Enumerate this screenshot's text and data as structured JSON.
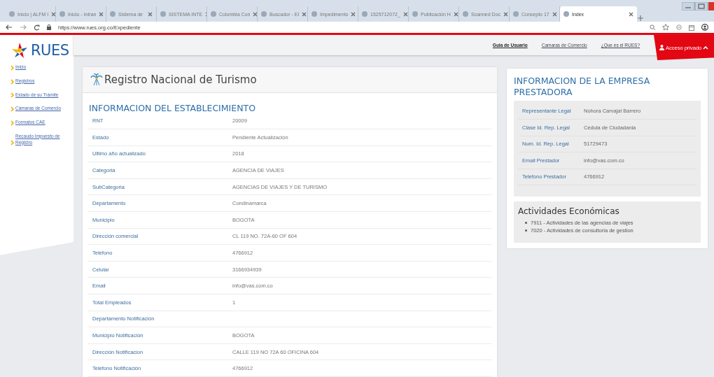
{
  "browser": {
    "tabs": [
      {
        "label": "Inicio | ALFM I",
        "selected": false
      },
      {
        "label": "Inicio - Intran",
        "selected": false
      },
      {
        "label": "Sistema de",
        "selected": false
      },
      {
        "label": "SISTEMA INTE",
        "selected": false
      },
      {
        "label": "Colombia Con",
        "selected": false
      },
      {
        "label": "Buscador - El",
        "selected": false
      },
      {
        "label": "Impedimento",
        "selected": false
      },
      {
        "label": "1525712072_",
        "selected": false
      },
      {
        "label": "Publicación H",
        "selected": false
      },
      {
        "label": "Scanned Doc",
        "selected": false
      },
      {
        "label": "Concepto 17",
        "selected": false
      },
      {
        "label": "Index",
        "selected": true
      }
    ],
    "url": "https://www.rues.org.co/Expediente"
  },
  "sidebar": {
    "logo": "RUES",
    "items": [
      "Inicio",
      "Registros",
      "Estado de su Trámite",
      "Cámaras de Comercio",
      "Formatos CAE",
      "Recaudo Impuesto de Registro"
    ]
  },
  "top_nav": {
    "links": [
      {
        "label": "Guia de Usuario",
        "selected": true
      },
      {
        "label": "Camaras de Comercio",
        "selected": false
      },
      {
        "label": "¿Que es el RUES?",
        "selected": false
      }
    ],
    "private_access": "Acceso privado"
  },
  "establishment": {
    "title": "Registro Nacional de Turismo",
    "heading": "INFORMACION DEL ESTABLECIMIENTO",
    "rows": [
      {
        "label": "RNT",
        "value": "20009"
      },
      {
        "label": "Estado",
        "value": "Pendiente Actualización"
      },
      {
        "label": "Ultimo año actualizado",
        "value": "2018"
      },
      {
        "label": "Categoria",
        "value": "AGENCIA DE VIAJES"
      },
      {
        "label": "SubCategoria",
        "value": "AGENCIAS DE VIAJES Y DE TURISMO"
      },
      {
        "label": "Departamento",
        "value": "Cundinamarca"
      },
      {
        "label": "Municipio",
        "value": "BOGOTA"
      },
      {
        "label": "Dirección comercial",
        "value": "CL 119 NO. 72A-60 OF 604"
      },
      {
        "label": "Telefono",
        "value": "4766912"
      },
      {
        "label": "Celular",
        "value": "3166934939"
      },
      {
        "label": "Email",
        "value": "info@vas.com.co"
      },
      {
        "label": "Total Empleados",
        "value": "1"
      },
      {
        "label": "Departamento Notificación"
      },
      {
        "label": "Municipio Notificación",
        "value": "BOGOTA"
      },
      {
        "label": "Dirección Notificacion",
        "value": "CALLE 119 NO 72A 60 OFICINA 604"
      },
      {
        "label": "Telefono Notificación",
        "value": "4766912"
      }
    ]
  },
  "company": {
    "heading": "INFORMACION DE LA EMPRESA PRESTADORA",
    "rows": [
      {
        "label": "Representante Legal",
        "value": "Nohora Carvajal Barrero"
      },
      {
        "label": "Clase Id. Rep. Legal",
        "value": "Cedula de Ciudadania"
      },
      {
        "label": "Num. Id. Rep. Legal",
        "value": "51729473"
      },
      {
        "label": "Email Prestador",
        "value": "info@vas.com.co"
      },
      {
        "label": "Telefono Prestador",
        "value": "4766912"
      }
    ],
    "activities": {
      "title": "Actividades Económicas",
      "items": [
        "7911 - Actividades de las agencias de viajes",
        "7020 - Actividades de consultoria de gestion"
      ]
    }
  }
}
